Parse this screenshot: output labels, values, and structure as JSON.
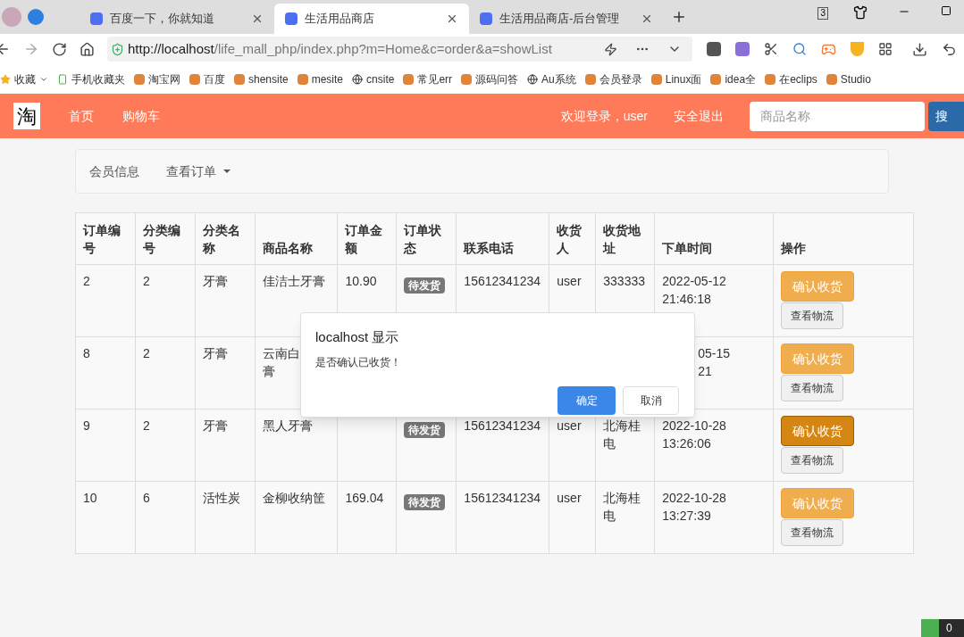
{
  "browser": {
    "tabs": [
      {
        "title": "百度一下，你就知道",
        "selected": false
      },
      {
        "title": "生活用品商店",
        "selected": true
      },
      {
        "title": "生活用品商店-后台管理",
        "selected": false
      }
    ],
    "tab_count": "3",
    "url_host": "http://localhost",
    "url_path": "/life_mall_php/index.php?m=Home&c=order&a=showList",
    "bookmarks": [
      "收藏",
      "手机收藏夹",
      "淘宝网",
      "百度",
      "shensite",
      "mesite",
      "cnsite",
      "常见err",
      "源码问答",
      "Au系统",
      "会员登录",
      "Linux面",
      "idea全",
      "在eclips",
      "Studio"
    ]
  },
  "navbar": {
    "logo": "淘",
    "links": [
      "首页",
      "购物车"
    ],
    "welcome": "欢迎登录，user",
    "logout": "安全退出",
    "search": {
      "placeholder": "商品名称"
    },
    "search_button": "搜"
  },
  "subnav": {
    "items": [
      "会员信息",
      "查看订单"
    ]
  },
  "table": {
    "columns": [
      "订单编号",
      "分类编号",
      "分类名称",
      "商品名称",
      "订单金额",
      "订单状态",
      "联系电话",
      "收货人",
      "收货地址",
      "下单时间",
      "操作"
    ],
    "rows": [
      {
        "cells": [
          [
            "2"
          ],
          [
            "2"
          ],
          [
            "牙膏"
          ],
          [
            "佳洁士牙膏"
          ],
          [
            "10.90"
          ],
          null,
          [
            "15612341234"
          ],
          [
            "user"
          ],
          [
            "333333"
          ],
          [
            "2022-05-12",
            "21:46:18"
          ]
        ],
        "status": "待发货",
        "confirm": "确认收货",
        "logistics": "查看物流",
        "hover": false,
        "shift_time": false
      },
      {
        "cells": [
          [
            "8"
          ],
          [
            "2"
          ],
          [
            "牙膏"
          ],
          [
            "云南白",
            "膏"
          ],
          null,
          null,
          null,
          null,
          null,
          [
            "05-15",
            "21"
          ]
        ],
        "confirm": "确认收货",
        "logistics": "查看物流",
        "hover": false,
        "shift_time": true
      },
      {
        "cells": [
          [
            "9"
          ],
          [
            "2"
          ],
          [
            "牙膏"
          ],
          [
            "黑人牙膏"
          ],
          null,
          null,
          [
            "15612341234"
          ],
          [
            "user"
          ],
          [
            "北海桂",
            "电"
          ],
          [
            "2022-10-28",
            "13:26:06"
          ]
        ],
        "status": "待发货",
        "confirm": "确认收货",
        "logistics": "查看物流",
        "hover": true,
        "shift_time": false
      },
      {
        "cells": [
          [
            "10"
          ],
          [
            "6"
          ],
          [
            "活性炭"
          ],
          [
            "金柳收纳筐"
          ],
          [
            "169.04"
          ],
          null,
          [
            "15612341234"
          ],
          [
            "user"
          ],
          [
            "北海桂",
            "电"
          ],
          [
            "2022-10-28",
            "13:27:39"
          ]
        ],
        "status": "待发货",
        "confirm": "确认收货",
        "logistics": "查看物流",
        "hover": false,
        "shift_time": false
      }
    ]
  },
  "dialog": {
    "title": "localhost 显示",
    "message": "是否确认已收货！",
    "ok": "确定",
    "cancel": "取消"
  },
  "corner_badge": "0"
}
